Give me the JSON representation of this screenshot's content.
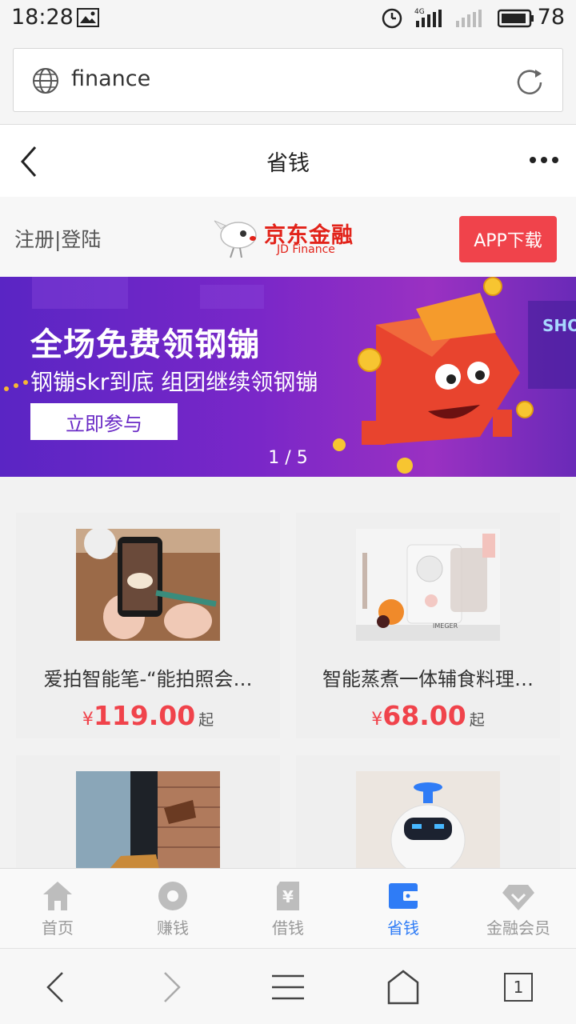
{
  "status_bar": {
    "time": "18:28",
    "network": "4G",
    "battery": "78"
  },
  "url_bar": {
    "url": "finance"
  },
  "nav": {
    "title": "省钱"
  },
  "jd_strip": {
    "register_login": "注册|登陆",
    "logo_cn": "京东金融",
    "logo_en": "JD Finance",
    "app_download": "APP下载"
  },
  "banner": {
    "headline": "全场免费领钢镚",
    "subline": "钢镚skr到底 组团继续领钢镚",
    "button": "立即参与",
    "pager": "1 / 5"
  },
  "products": [
    {
      "name": "爱拍智能笔-“能拍照会…",
      "yen": "¥",
      "price": "119.00",
      "suffix": "起"
    },
    {
      "name": "智能蒸煮一体辅食料理…",
      "yen": "¥",
      "price": "68.00",
      "suffix": "起"
    },
    {
      "name": "",
      "yen": "",
      "price": "",
      "suffix": ""
    },
    {
      "name": "",
      "yen": "",
      "price": "",
      "suffix": ""
    }
  ],
  "tabbar": [
    {
      "label": "首页",
      "icon": "home-icon"
    },
    {
      "label": "赚钱",
      "icon": "coin-icon"
    },
    {
      "label": "借钱",
      "icon": "loan-icon"
    },
    {
      "label": "省钱",
      "icon": "wallet-icon",
      "active": true
    },
    {
      "label": "金融会员",
      "icon": "diamond-icon"
    }
  ],
  "browser_bar": {
    "tab_count": "1"
  },
  "colors": {
    "accent_red": "#f0434b",
    "active_blue": "#2f7cf6",
    "banner_purple": "#6a2bc6"
  }
}
